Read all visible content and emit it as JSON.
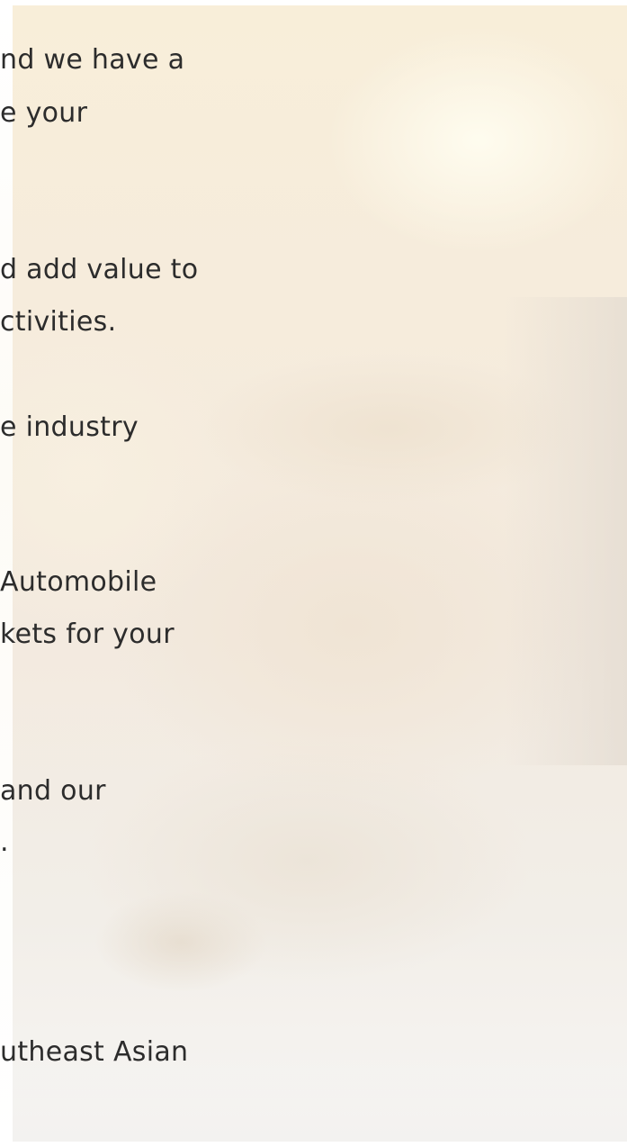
{
  "content": {
    "lines": [
      "nd we have a",
      "e your",
      "d add value to",
      "ctivities.",
      "e industry",
      " Automobile",
      "kets for your",
      "and our",
      ".",
      "utheast Asian"
    ]
  },
  "background": {
    "image": "handshake-photo"
  }
}
